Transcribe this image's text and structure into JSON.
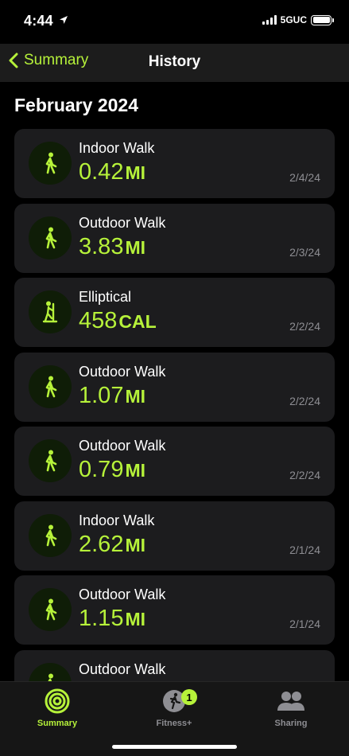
{
  "status_bar": {
    "time": "4:44",
    "network": "5GUC"
  },
  "nav": {
    "back_label": "Summary",
    "title": "History"
  },
  "section": {
    "title": "February 2024"
  },
  "workouts": [
    {
      "name": "Indoor Walk",
      "value": "0.42",
      "unit": "MI",
      "date": "2/4/24",
      "icon": "walking-icon"
    },
    {
      "name": "Outdoor Walk",
      "value": "3.83",
      "unit": "MI",
      "date": "2/3/24",
      "icon": "walking-icon"
    },
    {
      "name": "Elliptical",
      "value": "458",
      "unit": "CAL",
      "date": "2/2/24",
      "icon": "elliptical-icon"
    },
    {
      "name": "Outdoor Walk",
      "value": "1.07",
      "unit": "MI",
      "date": "2/2/24",
      "icon": "walking-icon"
    },
    {
      "name": "Outdoor Walk",
      "value": "0.79",
      "unit": "MI",
      "date": "2/2/24",
      "icon": "walking-icon"
    },
    {
      "name": "Indoor Walk",
      "value": "2.62",
      "unit": "MI",
      "date": "2/1/24",
      "icon": "walking-icon"
    },
    {
      "name": "Outdoor Walk",
      "value": "1.15",
      "unit": "MI",
      "date": "2/1/24",
      "icon": "walking-icon"
    },
    {
      "name": "Outdoor Walk",
      "value": "",
      "unit": "",
      "date": "",
      "icon": "walking-icon"
    }
  ],
  "tabbar": {
    "summary_label": "Summary",
    "fitness_label": "Fitness+",
    "fitness_badge": "1",
    "sharing_label": "Sharing"
  },
  "colors": {
    "accent": "#b6f23a",
    "card": "#1c1c1e",
    "background": "#000000"
  }
}
